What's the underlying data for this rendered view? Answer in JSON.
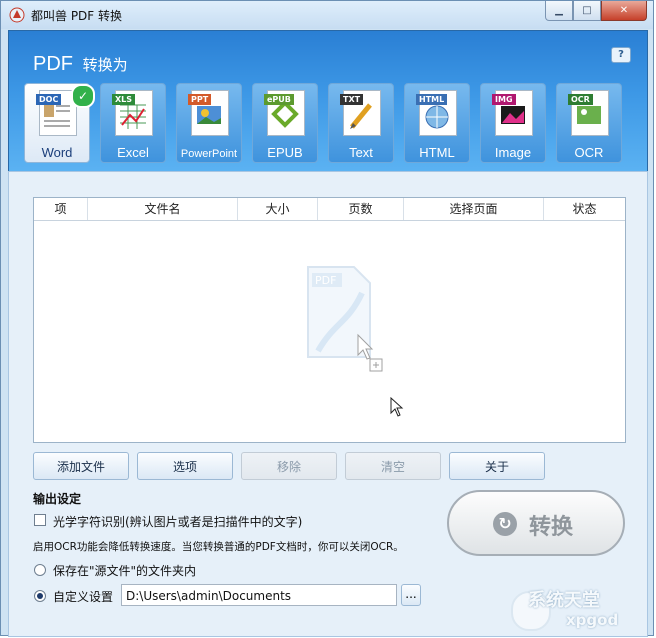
{
  "window": {
    "title": "都叫兽 PDF 转换"
  },
  "header": {
    "pdf_label": "PDF",
    "convert_to_label": "转换为",
    "help_symbol": "?"
  },
  "formats": [
    {
      "name": "word",
      "tag": "DOC",
      "label": "Word",
      "color": "#2b66b5"
    },
    {
      "name": "excel",
      "tag": "XLS",
      "label": "Excel",
      "color": "#2e8b3a"
    },
    {
      "name": "powerpoint",
      "tag": "PPT",
      "label": "PowerPoint",
      "color": "#d35a2a"
    },
    {
      "name": "epub",
      "tag": "ePUB",
      "label": "EPUB",
      "color": "#5c9a2f"
    },
    {
      "name": "text",
      "tag": "TXT",
      "label": "Text",
      "color": "#333333"
    },
    {
      "name": "html",
      "tag": "HTML",
      "label": "HTML",
      "color": "#3a6fb3"
    },
    {
      "name": "image",
      "tag": "IMG",
      "label": "Image",
      "color": "#b0176f"
    },
    {
      "name": "ocr",
      "tag": "OCR",
      "label": "OCR",
      "color": "#2e7d32"
    }
  ],
  "table": {
    "columns": [
      "项",
      "文件名",
      "大小",
      "页数",
      "选择页面",
      "状态"
    ]
  },
  "buttons": {
    "add": "添加文件",
    "options": "选项",
    "remove": "移除",
    "clear": "清空",
    "about": "关于"
  },
  "output": {
    "title": "输出设定",
    "ocr_checkbox_label": "光学字符识别(辨认图片或者是扫描件中的文字)",
    "ocr_note": "启用OCR功能会降低转换速度。当您转换普通的PDF文档时，你可以关闭OCR。",
    "save_in_source_label": "保存在\"源文件\"的文件夹内",
    "custom_label": "自定义设置",
    "custom_path": "D:\\Users\\admin\\Documents",
    "browse_label": "..."
  },
  "convert": {
    "label": "转换"
  },
  "watermark": {
    "line1": "系统天堂",
    "line2": "xpgod"
  }
}
